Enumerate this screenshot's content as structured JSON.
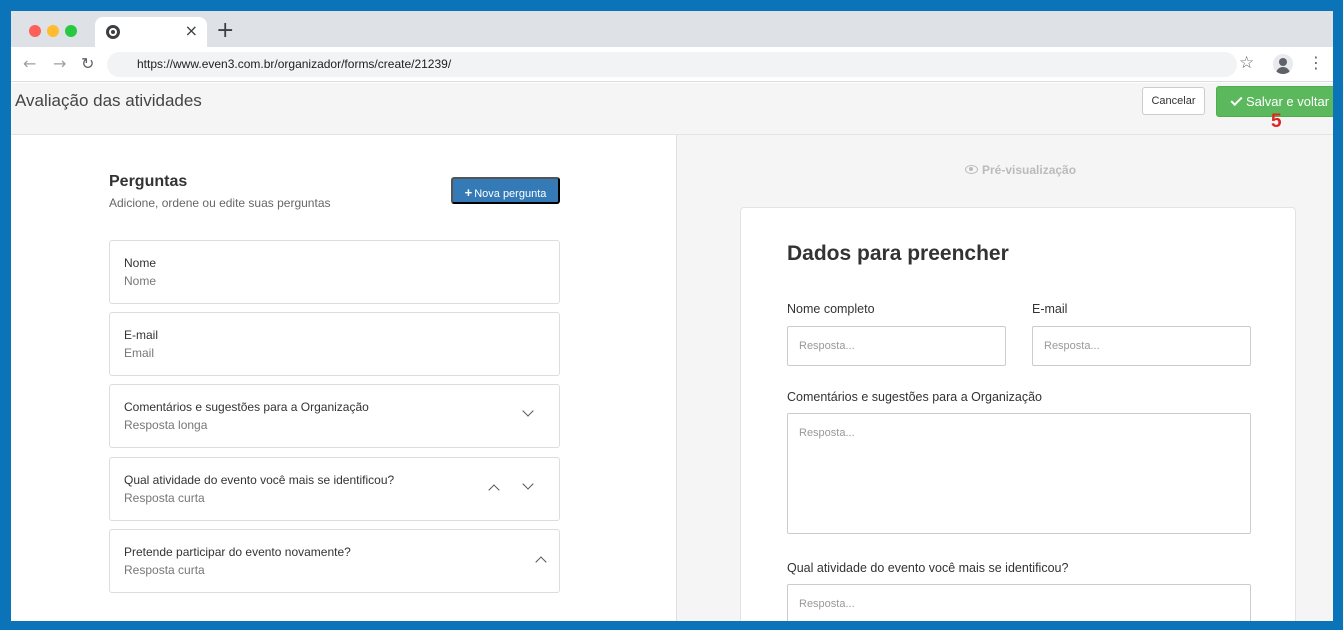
{
  "browser": {
    "new_tab": "+",
    "tab_close": "×",
    "url": "https://www.even3.com.br/organizador/forms/create/21239/",
    "icons": [
      "back-arrow-icon",
      "forward-arrow-icon",
      "reload-icon",
      "star-icon",
      "profile-icon",
      "menu-icon"
    ]
  },
  "header": {
    "title": "Avaliação das atividades",
    "cancel_label": "Cancelar",
    "save_label": "Salvar e voltar",
    "step_marker": "5"
  },
  "questions_panel": {
    "title": "Perguntas",
    "subtitle": "Adicione, ordene ou edite suas perguntas",
    "new_question_label": "Nova pergunta",
    "items": [
      {
        "label": "Nome",
        "type": "Nome"
      },
      {
        "label": "E-mail",
        "type": "Email"
      },
      {
        "label": "Comentários e sugestões para a Organização",
        "type": "Resposta longa"
      },
      {
        "label": "Qual atividade do evento você mais se identificou?",
        "type": "Resposta curta"
      },
      {
        "label": "Pretende participar do evento novamente?",
        "type": "Resposta curta"
      }
    ]
  },
  "preview": {
    "label": "Pré-visualização",
    "form_title": "Dados para preencher",
    "fields": [
      {
        "label": "Nome completo",
        "placeholder": "Resposta..."
      },
      {
        "label": "E-mail",
        "placeholder": "Resposta..."
      },
      {
        "label": "Comentários e sugestões para a Organização",
        "placeholder": "Resposta..."
      },
      {
        "label": "Qual atividade do evento você mais se identificou?",
        "placeholder": "Resposta..."
      }
    ]
  },
  "colors": {
    "save_button": "#5cb85c",
    "new_question_button": "#337ab7",
    "step_marker": "#e02424",
    "frame": "#0b73b7"
  }
}
